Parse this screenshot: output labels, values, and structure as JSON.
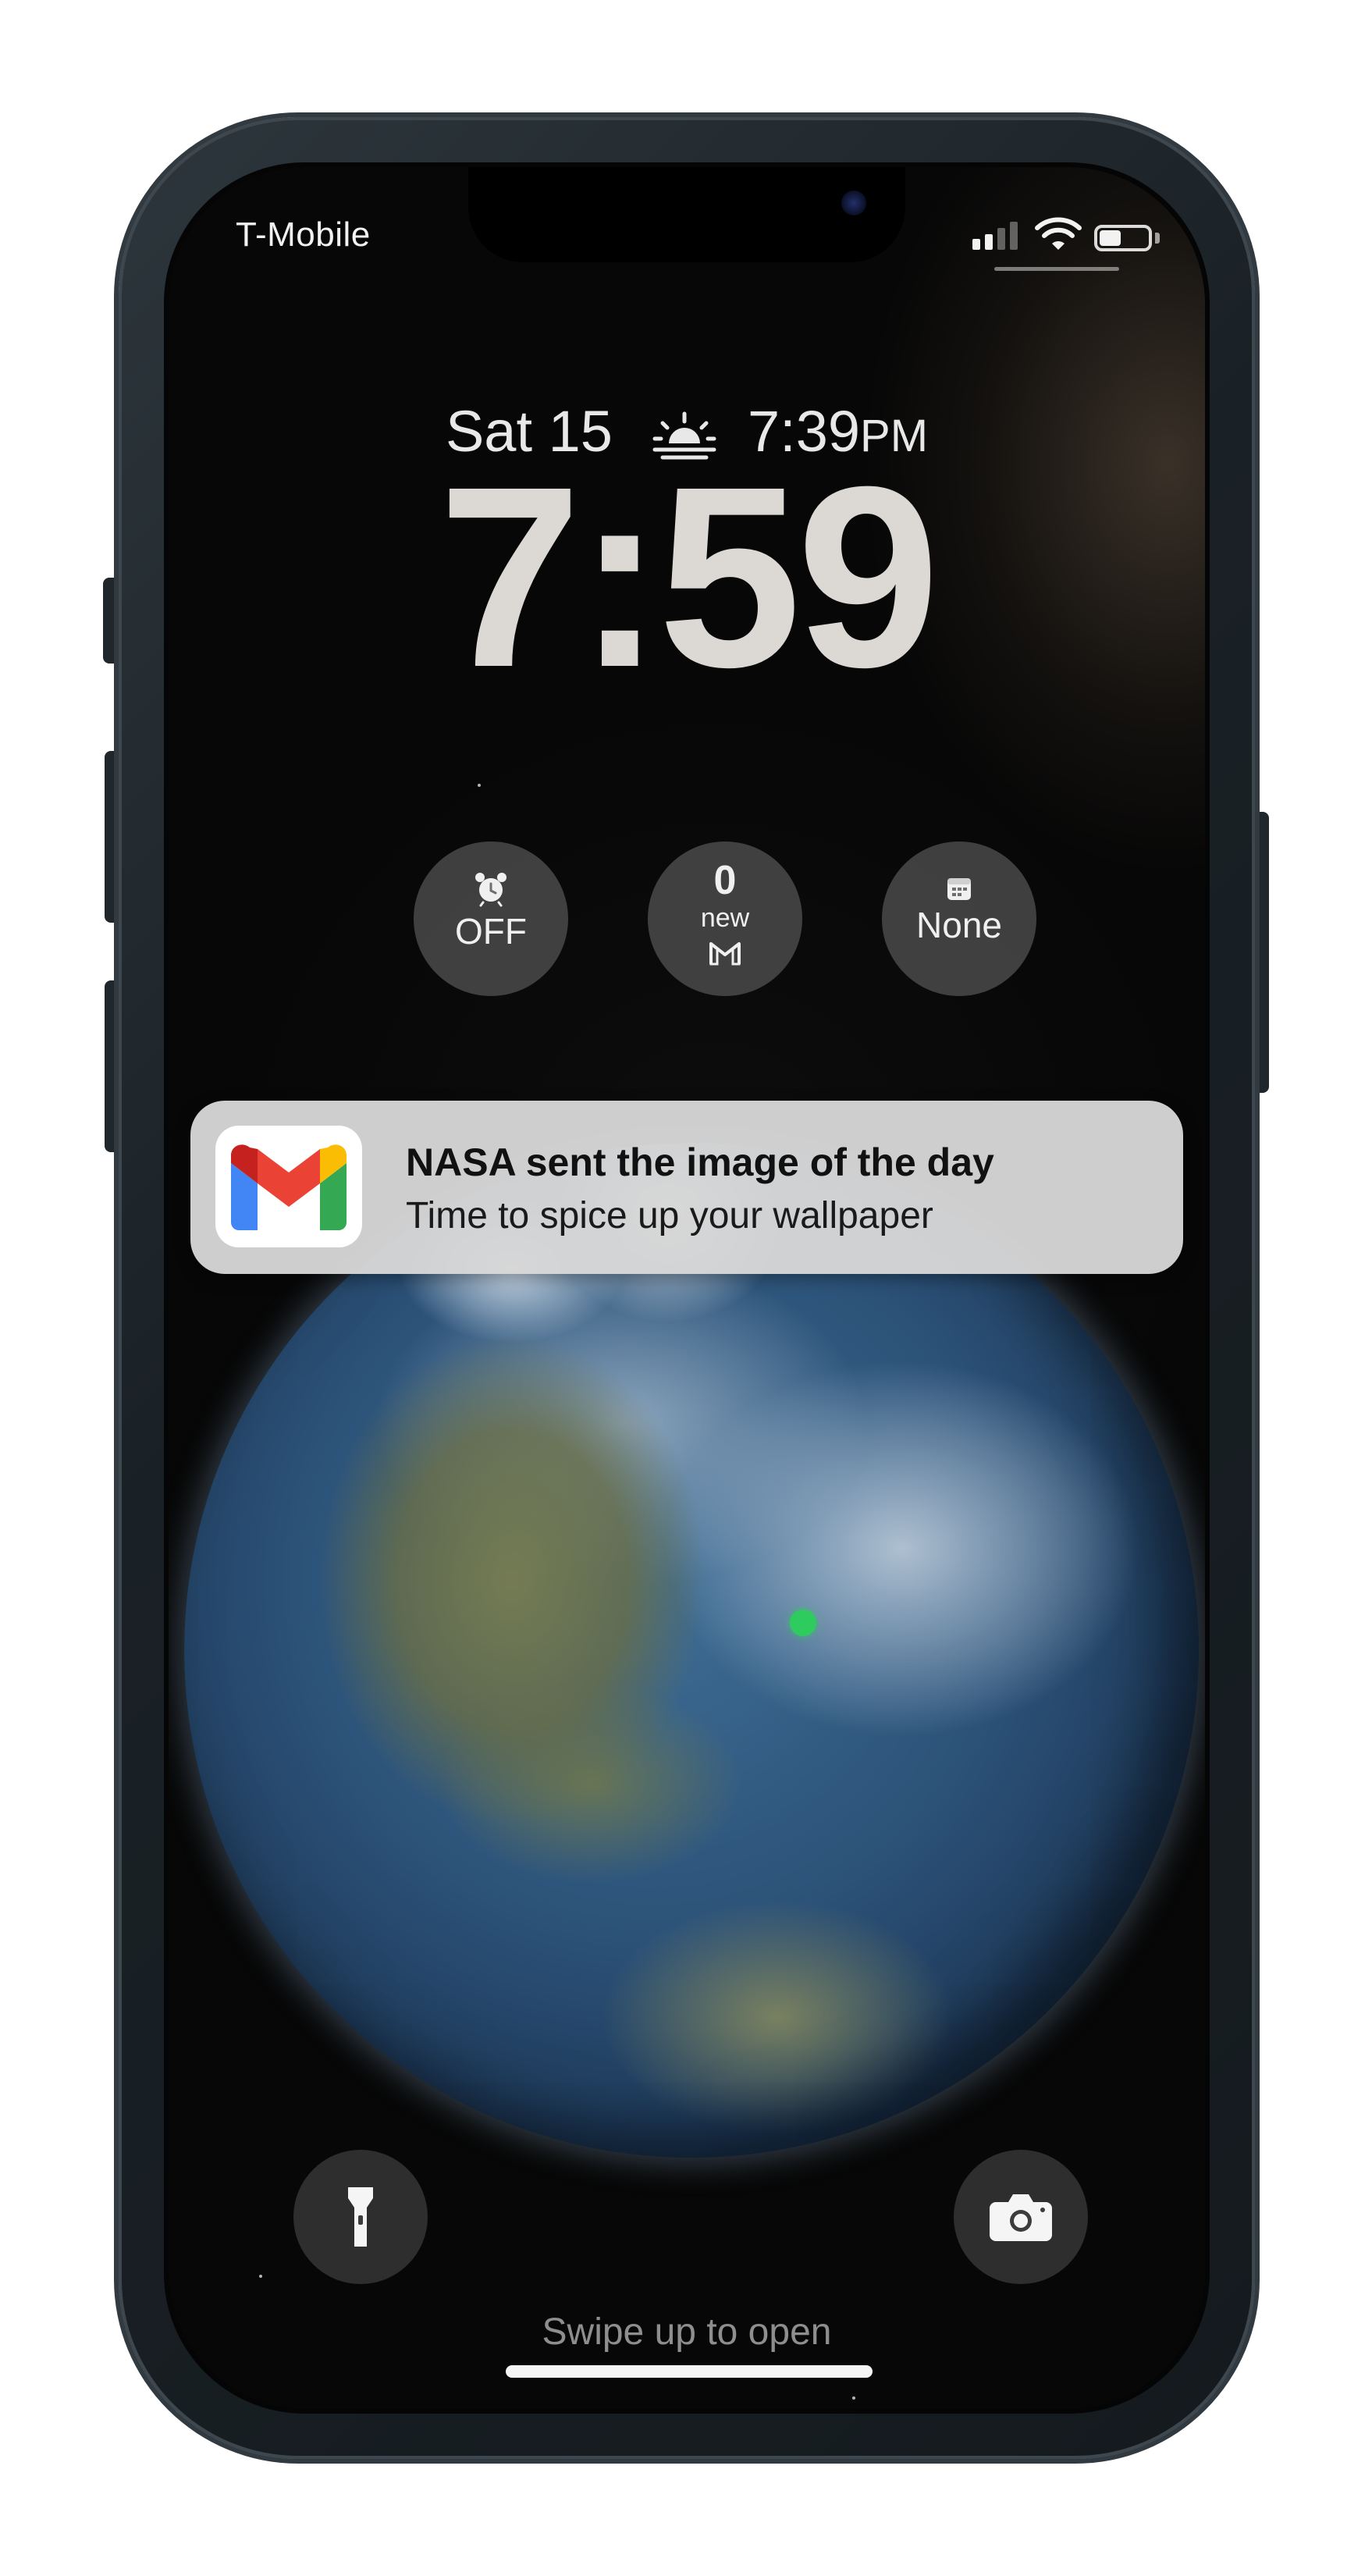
{
  "status_bar": {
    "carrier": "T-Mobile",
    "signal_bars": 2,
    "battery_fraction": 0.45
  },
  "lock_screen": {
    "date": "Sat 15",
    "sunset_time": "7:39",
    "sunset_ampm": "PM",
    "time": "7:59",
    "swipe_hint": "Swipe up to open"
  },
  "widgets": {
    "alarm": {
      "label": "OFF",
      "icon": "alarm-clock-icon"
    },
    "mail": {
      "count": "0",
      "sub": "new",
      "icon": "gmail-outline-icon"
    },
    "calendar": {
      "label": "None",
      "icon": "calendar-icon"
    }
  },
  "notification": {
    "app_icon": "gmail-icon",
    "title": "NASA sent the image of the day",
    "body": "Time to spice up your wallpaper"
  },
  "quick_actions": {
    "left": "flashlight-icon",
    "right": "camera-icon"
  },
  "colors": {
    "gmail_red": "#EA4335",
    "gmail_blue": "#4285F4",
    "gmail_green": "#34A853",
    "gmail_yellow": "#FBBC04",
    "location_dot": "#2ecc5e"
  }
}
